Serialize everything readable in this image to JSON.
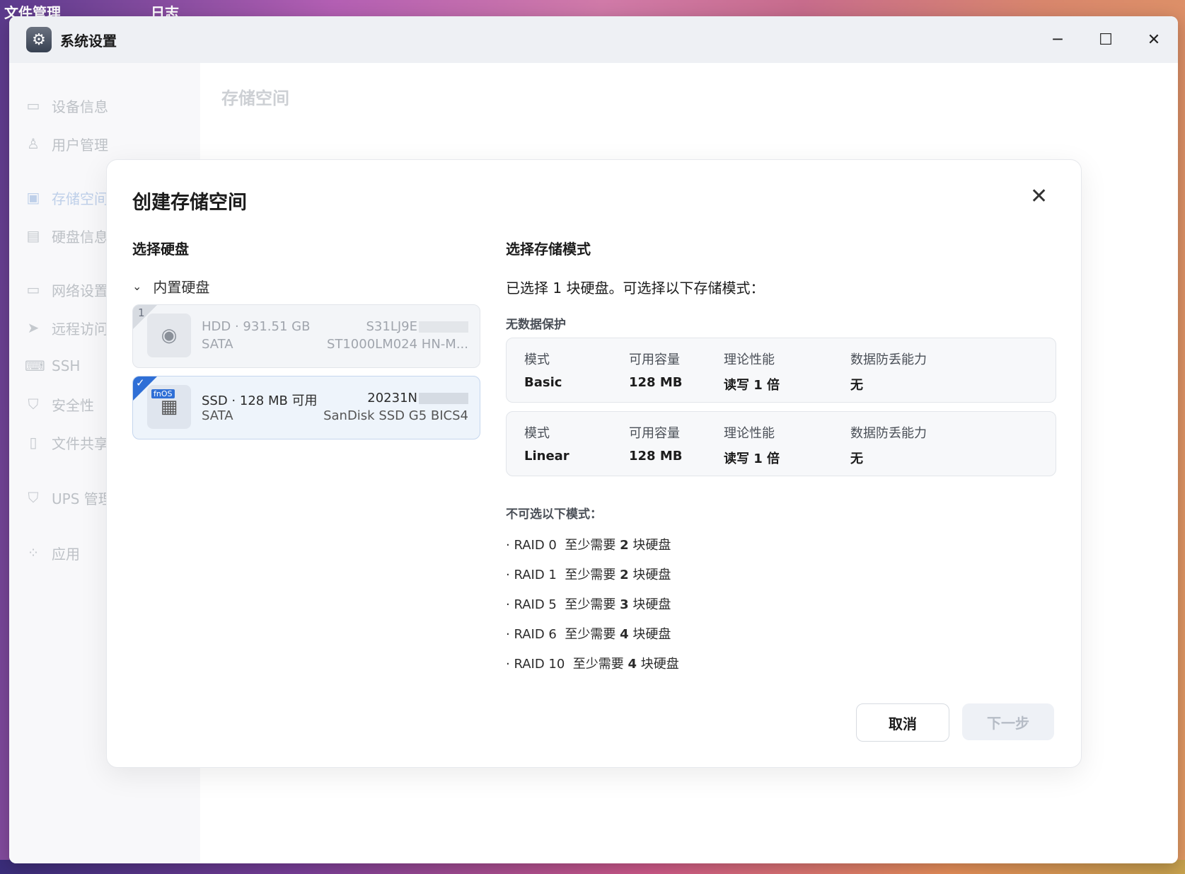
{
  "desktop": {
    "labels": [
      "文件管理",
      "日志"
    ]
  },
  "window": {
    "title": "系统设置",
    "controls": [
      "─",
      "☐",
      "✕"
    ]
  },
  "sidebar": {
    "items": [
      {
        "label": "设备信息",
        "icon": "monitor-icon"
      },
      {
        "label": "用户管理",
        "icon": "user-icon"
      },
      {
        "label": "存储空间",
        "icon": "storage-icon"
      },
      {
        "label": "硬盘信息",
        "icon": "disk-icon"
      },
      {
        "label": "网络设置",
        "icon": "network-icon"
      },
      {
        "label": "远程访问",
        "icon": "send-icon"
      },
      {
        "label": "SSH",
        "icon": "terminal-icon"
      },
      {
        "label": "安全性",
        "icon": "shield-check-icon"
      },
      {
        "label": "文件共享",
        "icon": "file-icon"
      },
      {
        "label": "UPS 管理",
        "icon": "shield-icon"
      },
      {
        "label": "应用",
        "icon": "apps-icon"
      }
    ],
    "active": "存储空间"
  },
  "page": {
    "title": "存储空间"
  },
  "modal": {
    "title": "创建存储空间",
    "close": "✕",
    "left": {
      "title": "选择硬盘",
      "group_label": "内置硬盘",
      "disks": [
        {
          "index": "1",
          "line1": "HDD · 931.51 GB",
          "line2": "SATA",
          "serial": "S31LJ9E",
          "model": "ST1000LM024 HN-M...",
          "selected": false
        },
        {
          "badge": "fnOS",
          "check": "✓",
          "line1": "SSD · 128 MB 可用",
          "line2": "SATA",
          "serial": "20231N",
          "model": "SanDisk SSD G5 BICS4",
          "selected": true
        }
      ]
    },
    "right": {
      "title": "选择存储模式",
      "summary": "已选择 1 块硬盘。可选择以下存储模式：",
      "no_protection_label": "无数据保护",
      "headers": {
        "mode": "模式",
        "capacity": "可用容量",
        "performance": "理论性能",
        "tolerance": "数据防丢能力"
      },
      "modes": [
        {
          "mode": "Basic",
          "capacity": "128 MB",
          "performance": "读写 1 倍",
          "tolerance": "无"
        },
        {
          "mode": "Linear",
          "capacity": "128 MB",
          "performance": "读写 1 倍",
          "tolerance": "无"
        }
      ],
      "unavailable_label": "不可选以下模式：",
      "unavailable": [
        {
          "name": "· RAID 0",
          "req_pre": "至少需要",
          "req_num": "2",
          "req_post": "块硬盘"
        },
        {
          "name": "· RAID 1",
          "req_pre": "至少需要",
          "req_num": "2",
          "req_post": "块硬盘"
        },
        {
          "name": "· RAID 5",
          "req_pre": "至少需要",
          "req_num": "3",
          "req_post": "块硬盘"
        },
        {
          "name": "· RAID 6",
          "req_pre": "至少需要",
          "req_num": "4",
          "req_post": "块硬盘"
        },
        {
          "name": "· RAID 10",
          "req_pre": "至少需要",
          "req_num": "4",
          "req_post": "块硬盘"
        }
      ]
    },
    "buttons": {
      "cancel": "取消",
      "next": "下一步"
    }
  }
}
